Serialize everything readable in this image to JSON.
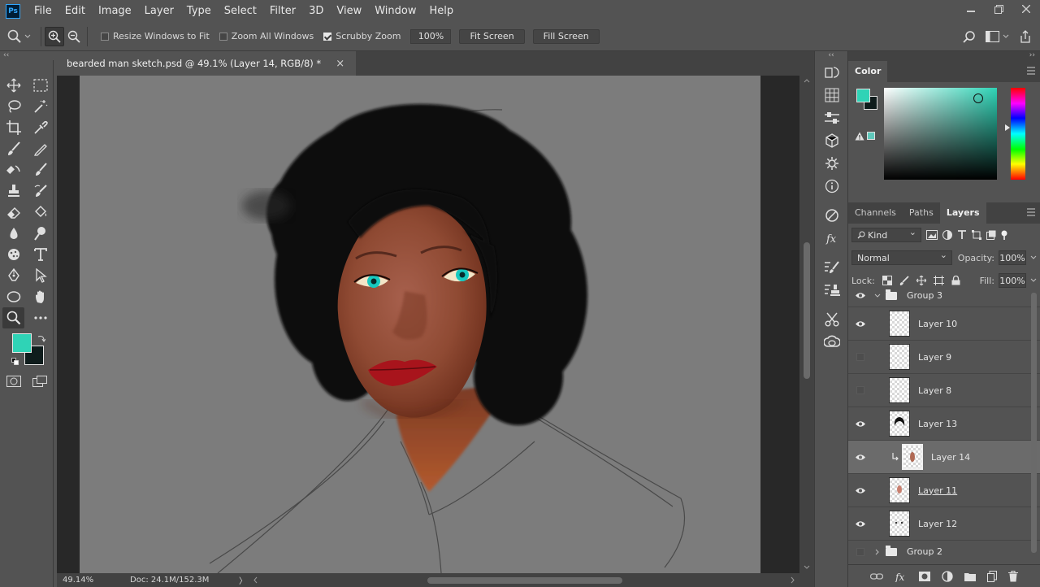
{
  "app": {
    "logo": "Ps"
  },
  "menu": [
    "File",
    "Edit",
    "Image",
    "Layer",
    "Type",
    "Select",
    "Filter",
    "3D",
    "View",
    "Window",
    "Help"
  ],
  "options": {
    "resize_windows": "Resize Windows to Fit",
    "zoom_all": "Zoom All Windows",
    "scrubby_zoom": "Scrubby Zoom",
    "zoom_value": "100%",
    "fit_screen": "Fit Screen",
    "fill_screen": "Fill Screen"
  },
  "document": {
    "tab_title": "bearded man sketch.psd @ 49.1% (Layer 14, RGB/8) *",
    "close": "×"
  },
  "status": {
    "zoom": "49.14%",
    "doc": "Doc: 24.1M/152.3M",
    "arrow": "〉"
  },
  "panels": {
    "color_tab": "Color",
    "tabs": [
      "Channels",
      "Paths",
      "Layers"
    ],
    "kind": "Kind",
    "blend_mode": "Normal",
    "opacity_label": "Opacity:",
    "opacity_value": "100%",
    "lock_label": "Lock:",
    "fill_label": "Fill:",
    "fill_value": "100%"
  },
  "layers": {
    "group3": "Group 3",
    "items": [
      {
        "name": "Layer 10",
        "visible": true
      },
      {
        "name": "Layer 9",
        "visible": false
      },
      {
        "name": "Layer 8",
        "visible": false
      },
      {
        "name": "Layer 13",
        "visible": true
      },
      {
        "name": "Layer 14",
        "visible": true
      },
      {
        "name": "Layer 11",
        "visible": true
      },
      {
        "name": "Layer 12",
        "visible": true
      }
    ],
    "group2": "Group 2"
  },
  "colors": {
    "foreground": "#2fd3b6",
    "background": "#0f1c1c",
    "accent": "#31a8ff"
  }
}
